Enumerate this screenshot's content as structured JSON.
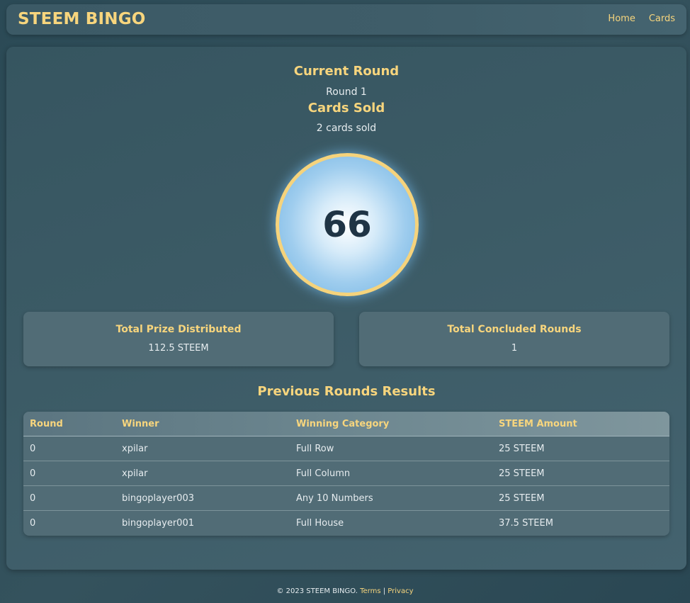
{
  "navbar": {
    "brand": "STEEM BINGO",
    "links": [
      "Home",
      "Cards"
    ]
  },
  "current_round": {
    "heading": "Current Round",
    "value": "Round 1"
  },
  "cards_sold": {
    "heading": "Cards Sold",
    "value": "2 cards sold"
  },
  "current_ball": {
    "number": "66"
  },
  "stats": {
    "prize": {
      "title": "Total Prize Distributed",
      "value": "112.5 STEEM"
    },
    "rounds": {
      "title": "Total Concluded Rounds",
      "value": "1"
    }
  },
  "previous": {
    "heading": "Previous Rounds Results",
    "columns": [
      "Round",
      "Winner",
      "Winning Category",
      "STEEM Amount"
    ],
    "rows": [
      [
        "0",
        "xpilar",
        "Full Row",
        "25 STEEM"
      ],
      [
        "0",
        "xpilar",
        "Full Column",
        "25 STEEM"
      ],
      [
        "0",
        "bingoplayer003",
        "Any 10 Numbers",
        "25 STEEM"
      ],
      [
        "0",
        "bingoplayer001",
        "Full House",
        "37.5 STEEM"
      ]
    ]
  },
  "footer": {
    "copyright": "© 2023 STEEM BINGO.",
    "terms": "Terms",
    "separator": "|",
    "privacy": "Privacy"
  },
  "colors": {
    "accent": "#f7d57d",
    "background": "#2b4a56",
    "card": "#516c76",
    "ball_number": "#1f3445"
  }
}
